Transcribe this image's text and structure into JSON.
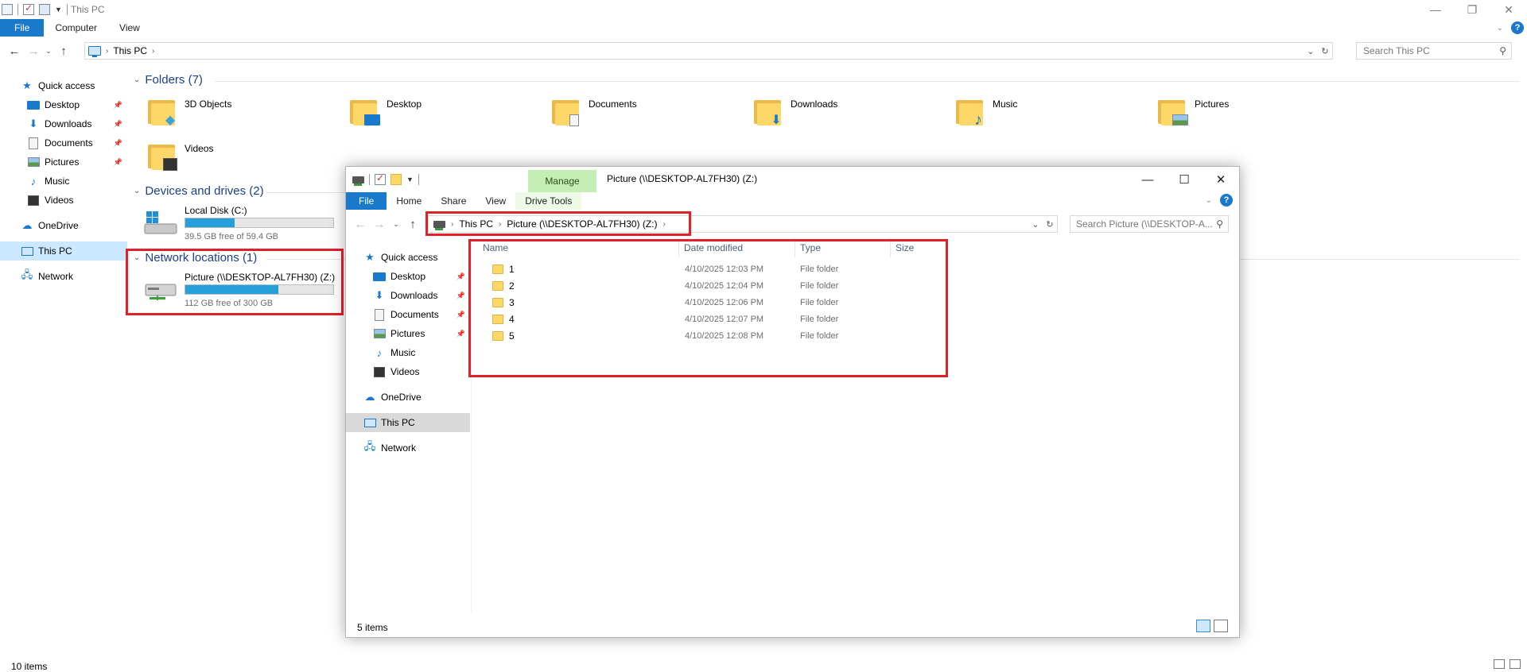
{
  "main": {
    "title": "This PC",
    "window_controls": [
      "—",
      "❐",
      "✕"
    ],
    "tabs": [
      {
        "label": "File"
      },
      {
        "label": "Computer"
      },
      {
        "label": "View"
      }
    ],
    "breadcrumb": [
      "This PC"
    ],
    "search_placeholder": "Search This PC",
    "nav": [
      {
        "label": "Quick access",
        "icon": "star-icon",
        "pinned": false
      },
      {
        "label": "Desktop",
        "icon": "desktop-icon",
        "pinned": true
      },
      {
        "label": "Downloads",
        "icon": "download-arrow-icon",
        "pinned": true
      },
      {
        "label": "Documents",
        "icon": "documents-icon",
        "pinned": true
      },
      {
        "label": "Pictures",
        "icon": "pictures-icon",
        "pinned": true
      },
      {
        "label": "Music",
        "icon": "music-note-icon",
        "pinned": false
      },
      {
        "label": "Videos",
        "icon": "video-icon",
        "pinned": false
      },
      {
        "label": "OneDrive",
        "icon": "cloud-icon",
        "pinned": false
      },
      {
        "label": "This PC",
        "icon": "computer-icon",
        "pinned": false
      },
      {
        "label": "Network",
        "icon": "network-icon",
        "pinned": false
      }
    ],
    "folders_header": "Folders (7)",
    "folders": [
      {
        "label": "3D Objects",
        "badge": "cube-icon"
      },
      {
        "label": "Desktop",
        "badge": "desktop-icon"
      },
      {
        "label": "Documents",
        "badge": "documents-icon"
      },
      {
        "label": "Downloads",
        "badge": "download-arrow-icon"
      },
      {
        "label": "Music",
        "badge": "music-note-icon"
      },
      {
        "label": "Pictures",
        "badge": "pictures-icon"
      },
      {
        "label": "Videos",
        "badge": "video-icon"
      }
    ],
    "devices_header": "Devices and drives (2)",
    "local_disk": {
      "name": "Local Disk (C:)",
      "free": "39.5 GB free of 59.4 GB",
      "used_fraction": 0.335
    },
    "network_header": "Network locations (1)",
    "network_drive": {
      "name": "Picture (\\\\DESKTOP-AL7FH30) (Z:)",
      "free": "112 GB free of 300 GB",
      "used_fraction": 0.627
    },
    "status": "10 items"
  },
  "window2": {
    "title": "Picture (\\\\DESKTOP-AL7FH30) (Z:)",
    "context_tab": "Manage",
    "tabs": [
      {
        "label": "File"
      },
      {
        "label": "Home"
      },
      {
        "label": "Share"
      },
      {
        "label": "View"
      },
      {
        "label": "Drive Tools"
      }
    ],
    "breadcrumb": [
      "This PC",
      "Picture (\\\\DESKTOP-AL7FH30) (Z:)"
    ],
    "search_placeholder": "Search Picture (\\\\DESKTOP-A...",
    "nav": [
      {
        "label": "Quick access",
        "icon": "star-icon"
      },
      {
        "label": "Desktop",
        "icon": "desktop-icon"
      },
      {
        "label": "Downloads",
        "icon": "download-arrow-icon"
      },
      {
        "label": "Documents",
        "icon": "documents-icon"
      },
      {
        "label": "Pictures",
        "icon": "pictures-icon"
      },
      {
        "label": "Music",
        "icon": "music-note-icon"
      },
      {
        "label": "Videos",
        "icon": "video-icon"
      },
      {
        "label": "OneDrive",
        "icon": "cloud-icon"
      },
      {
        "label": "This PC",
        "icon": "computer-icon"
      },
      {
        "label": "Network",
        "icon": "network-icon"
      }
    ],
    "columns": {
      "name": "Name",
      "date": "Date modified",
      "type": "Type",
      "size": "Size"
    },
    "rows": [
      {
        "name": "1",
        "date": "4/10/2025 12:03 PM",
        "type": "File folder",
        "size": ""
      },
      {
        "name": "2",
        "date": "4/10/2025 12:04 PM",
        "type": "File folder",
        "size": ""
      },
      {
        "name": "3",
        "date": "4/10/2025 12:06 PM",
        "type": "File folder",
        "size": ""
      },
      {
        "name": "4",
        "date": "4/10/2025 12:07 PM",
        "type": "File folder",
        "size": ""
      },
      {
        "name": "5",
        "date": "4/10/2025 12:08 PM",
        "type": "File folder",
        "size": ""
      }
    ],
    "status": "5 items"
  },
  "colors": {
    "accent": "#1979ca",
    "highlight": "#e3202a",
    "manage_tab": "#c5eeb5",
    "header_text": "#1e3e8c"
  }
}
